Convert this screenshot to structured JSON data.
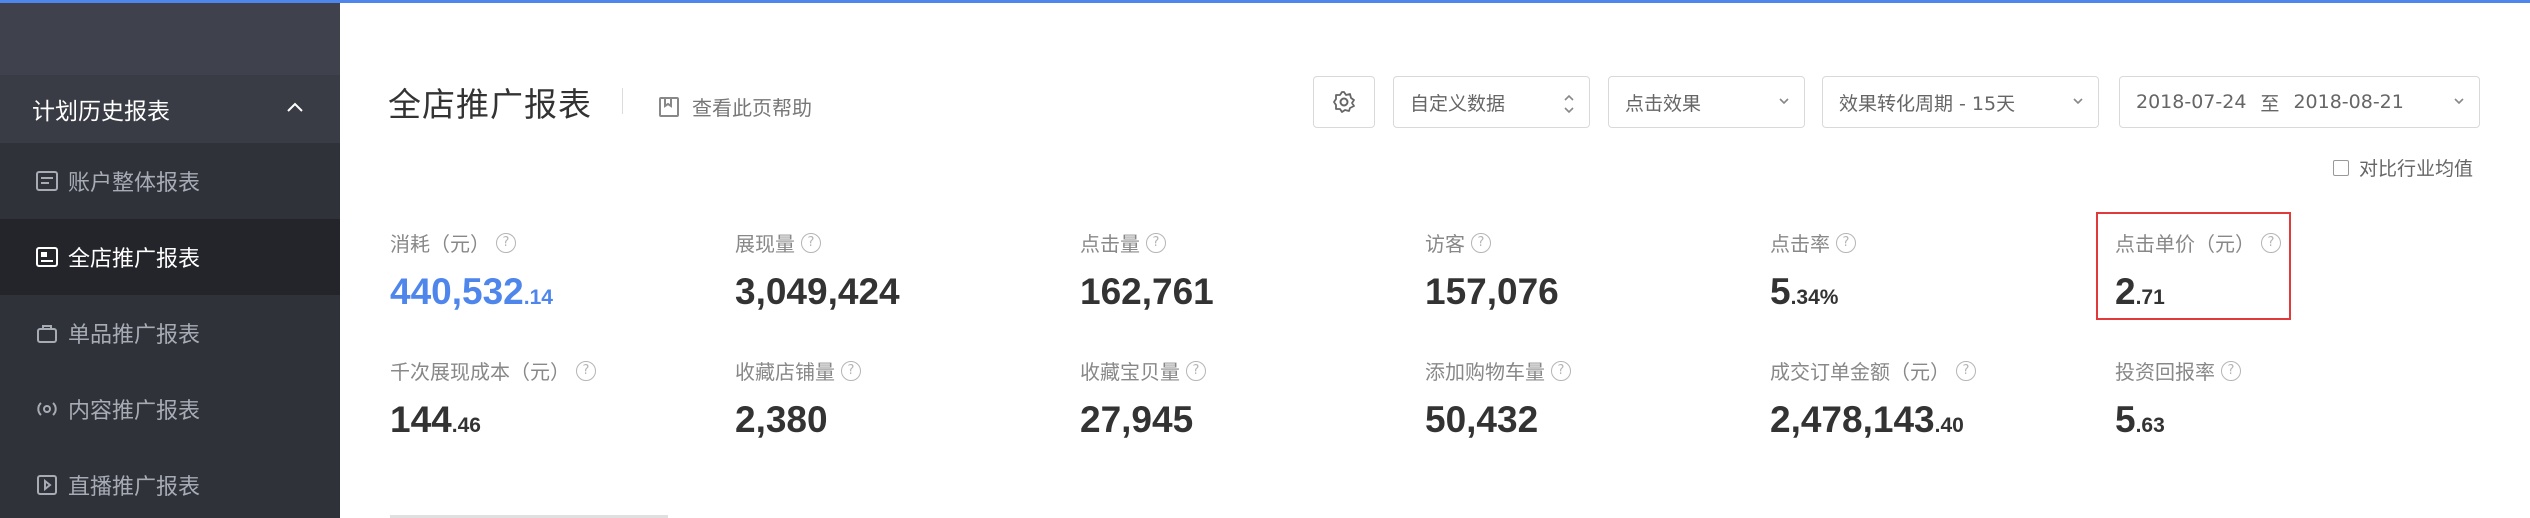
{
  "sidebar": {
    "group_label": "计划历史报表",
    "items": [
      {
        "label": "账户整体报表",
        "icon": "report-icon",
        "active": false
      },
      {
        "label": "全店推广报表",
        "icon": "image-card-icon",
        "active": true
      },
      {
        "label": "单品推广报表",
        "icon": "bag-icon",
        "active": false
      },
      {
        "label": "内容推广报表",
        "icon": "broadcast-icon",
        "active": false
      },
      {
        "label": "直播推广报表",
        "icon": "live-play-icon",
        "active": false
      }
    ]
  },
  "header": {
    "title": "全店推广报表",
    "help_label": "查看此页帮助"
  },
  "toolbar": {
    "custom_data": "自定义数据",
    "click_effect": "点击效果",
    "conversion_period": "效果转化周期 - 15天",
    "date_start": "2018-07-24",
    "date_sep": "至",
    "date_end": "2018-08-21",
    "compare_label": "对比行业均值"
  },
  "metrics": [
    {
      "label": "消耗（元）",
      "int": "440,532",
      "dec": ".14",
      "highlight_color": "#4f86ec"
    },
    {
      "label": "展现量",
      "int": "3,049,424",
      "dec": ""
    },
    {
      "label": "点击量",
      "int": "162,761",
      "dec": ""
    },
    {
      "label": "访客",
      "int": "157,076",
      "dec": ""
    },
    {
      "label": "点击率",
      "int": "5",
      "dec": ".34%"
    },
    {
      "label": "点击单价（元）",
      "int": "2",
      "dec": ".71"
    },
    {
      "label": "千次展现成本（元）",
      "int": "144",
      "dec": ".46"
    },
    {
      "label": "收藏店铺量",
      "int": "2,380",
      "dec": ""
    },
    {
      "label": "收藏宝贝量",
      "int": "27,945",
      "dec": ""
    },
    {
      "label": "添加购物车量",
      "int": "50,432",
      "dec": ""
    },
    {
      "label": "成交订单金额（元）",
      "int": "2,478,143",
      "dec": ".40"
    },
    {
      "label": "投资回报率",
      "int": "5",
      "dec": ".63"
    }
  ],
  "colors": {
    "accent": "#4f86ec",
    "sidebar_bg": "#3f424c",
    "highlight_border": "#e23a3a"
  }
}
